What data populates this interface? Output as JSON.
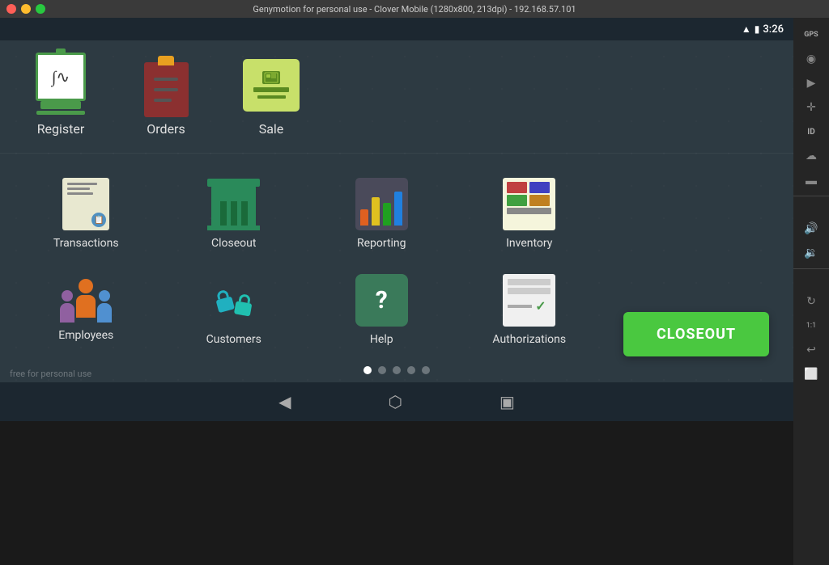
{
  "titlebar": {
    "title": "Genymotion for personal use - Clover Mobile (1280x800, 213dpi) - 192.168.57.101"
  },
  "statusbar": {
    "time": "3:26"
  },
  "apps": {
    "top": [
      {
        "id": "register",
        "label": "Register"
      },
      {
        "id": "orders",
        "label": "Orders"
      },
      {
        "id": "sale",
        "label": "Sale"
      }
    ],
    "bottom": [
      {
        "id": "transactions",
        "label": "Transactions"
      },
      {
        "id": "closeout",
        "label": "Closeout"
      },
      {
        "id": "reporting",
        "label": "Reporting"
      },
      {
        "id": "inventory",
        "label": "Inventory"
      },
      {
        "id": "employees",
        "label": "Employees"
      },
      {
        "id": "customers",
        "label": "Customers"
      },
      {
        "id": "help",
        "label": "Help"
      },
      {
        "id": "authorizations",
        "label": "Authorizations"
      }
    ]
  },
  "closeout_button": {
    "label": "CLOSEOUT"
  },
  "watermark": {
    "text": "free for personal use"
  },
  "pagination": {
    "total": 5,
    "active": 0
  }
}
